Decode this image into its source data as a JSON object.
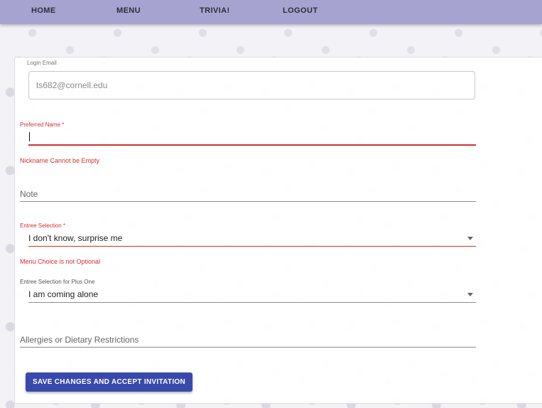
{
  "nav": {
    "items": [
      "HOME",
      "MENU",
      "TRIVIA!",
      "LOGOUT"
    ],
    "bar_color": "#a7a3d0"
  },
  "form": {
    "login_email": {
      "label": "Login Email",
      "value": "ts682@cornell.edu"
    },
    "preferred_name": {
      "label": "Preferred Name *",
      "value": "",
      "error": "Nickname Cannot be Empty"
    },
    "note": {
      "placeholder": "Note",
      "value": ""
    },
    "entree": {
      "label": "Entree Selection *",
      "value": "I don't know, surprise me",
      "error": "Menu Choice is not Optional"
    },
    "entree_plus_one": {
      "label": "Entree Selection for Plus One",
      "value": "I am coming alone"
    },
    "allergies": {
      "placeholder": "Allergies or Dietary Restrictions",
      "value": ""
    },
    "submit_label": "SAVE CHANGES AND ACCEPT INVITATION"
  },
  "colors": {
    "primary": "#3949ab",
    "error": "#d32f2f"
  }
}
